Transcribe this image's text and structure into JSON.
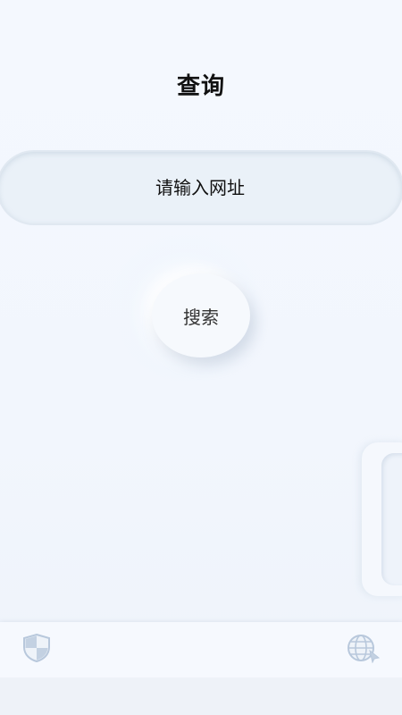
{
  "header": {
    "title": "查询"
  },
  "url_input": {
    "placeholder": "请输入网址",
    "value": ""
  },
  "search_button": {
    "label": "搜索"
  },
  "bottom_nav": {
    "items": [
      {
        "icon": "shield-icon"
      },
      {
        "icon": "globe-icon"
      }
    ]
  },
  "colors": {
    "background": "#f3f7fd",
    "input_fill": "#eaf1f8",
    "icon": "#b8c8dc"
  }
}
